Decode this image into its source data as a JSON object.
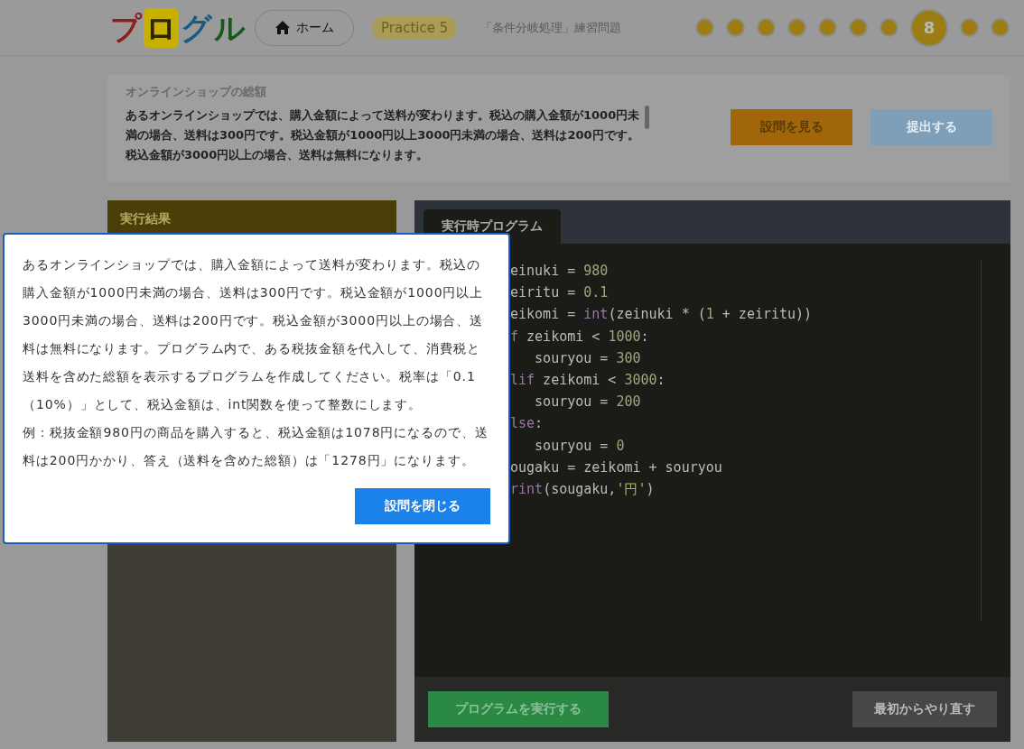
{
  "header": {
    "logo": "プログル",
    "home_button": "ホーム",
    "badge": "Practice 5",
    "subtitle": "「条件分岐処理」練習問題",
    "progress": [
      {
        "selected": false
      },
      {
        "selected": false
      },
      {
        "selected": false
      },
      {
        "selected": false
      },
      {
        "selected": false
      },
      {
        "selected": false
      },
      {
        "selected": false
      },
      {
        "selected": true,
        "label": "8"
      },
      {
        "selected": false
      },
      {
        "selected": false
      }
    ]
  },
  "question": {
    "title": "オンラインショップの総額",
    "text": "あるオンラインショップでは、購入金額によって送料が変わります。税込の購入金額が1000円未満の場合、送料は300円です。税込金額が1000円以上3000円未満の場合、送料は200円です。税込金額が3000円以上の場合、送料は無料になります。",
    "buttons": [
      {
        "label": "設問を見る",
        "kind": "primary"
      },
      {
        "label": "提出する",
        "kind": "submit"
      }
    ]
  },
  "result_panel": {
    "title": "実行結果"
  },
  "editor": {
    "tab": "実行時プログラム",
    "lines": [
      [
        {
          "text": "einuki = ",
          "kind": "plain"
        },
        {
          "text": "980",
          "kind": "number"
        }
      ],
      [
        {
          "text": "eiritu = ",
          "kind": "plain"
        },
        {
          "text": "0.1",
          "kind": "number"
        }
      ],
      [
        {
          "text": "eikomi = ",
          "kind": "plain"
        },
        {
          "text": "int",
          "kind": "keyword"
        },
        {
          "text": "(zeinuki * (",
          "kind": "plain"
        },
        {
          "text": "1",
          "kind": "number"
        },
        {
          "text": " + zeiritu))",
          "kind": "plain"
        }
      ],
      [
        {
          "text": "f",
          "kind": "keyword"
        },
        {
          "text": " zeikomi < ",
          "kind": "plain"
        },
        {
          "text": "1000",
          "kind": "number"
        },
        {
          "text": ":",
          "kind": "plain"
        }
      ],
      [
        {
          "text": "   souryou = ",
          "kind": "plain"
        },
        {
          "text": "300",
          "kind": "number"
        }
      ],
      [
        {
          "text": "lif",
          "kind": "keyword"
        },
        {
          "text": " zeikomi < ",
          "kind": "plain"
        },
        {
          "text": "3000",
          "kind": "number"
        },
        {
          "text": ":",
          "kind": "plain"
        }
      ],
      [
        {
          "text": "   souryou = ",
          "kind": "plain"
        },
        {
          "text": "200",
          "kind": "number"
        }
      ],
      [
        {
          "text": "lse",
          "kind": "keyword"
        },
        {
          "text": ":",
          "kind": "plain"
        }
      ],
      [
        {
          "text": "   souryou = ",
          "kind": "plain"
        },
        {
          "text": "0",
          "kind": "number"
        }
      ],
      [
        {
          "text": "ougaku = zeikomi + souryou",
          "kind": "plain"
        }
      ],
      [
        {
          "text": "rint",
          "kind": "keyword"
        },
        {
          "text": "(sougaku,",
          "kind": "plain"
        },
        {
          "text": "'円'",
          "kind": "string"
        },
        {
          "text": ")",
          "kind": "plain"
        }
      ]
    ],
    "run_button": "プログラムを実行する",
    "reset_button": "最初からやり直す"
  },
  "modal": {
    "paragraphs": [
      "あるオンラインショップでは、購入金額によって送料が変わります。税込の購入金額が1000円未満の場合、送料は300円です。税込金額が1000円以上3000円未満の場合、送料は200円です。税込金額が3000円以上の場合、送料は無料になります。プログラム内で、ある税抜金額を代入して、消費税と送料を含めた総額を表示するプログラムを作成してください。税率は「0.1（10%）」として、税込金額は、int関数を使って整数にします。",
      "例：税抜金額980円の商品を購入すると、税込金額は1078円になるので、送料は200円かかり、答え（送料を含めた総額）は「1278円」になります。"
    ],
    "close_button": "設問を閉じる"
  }
}
